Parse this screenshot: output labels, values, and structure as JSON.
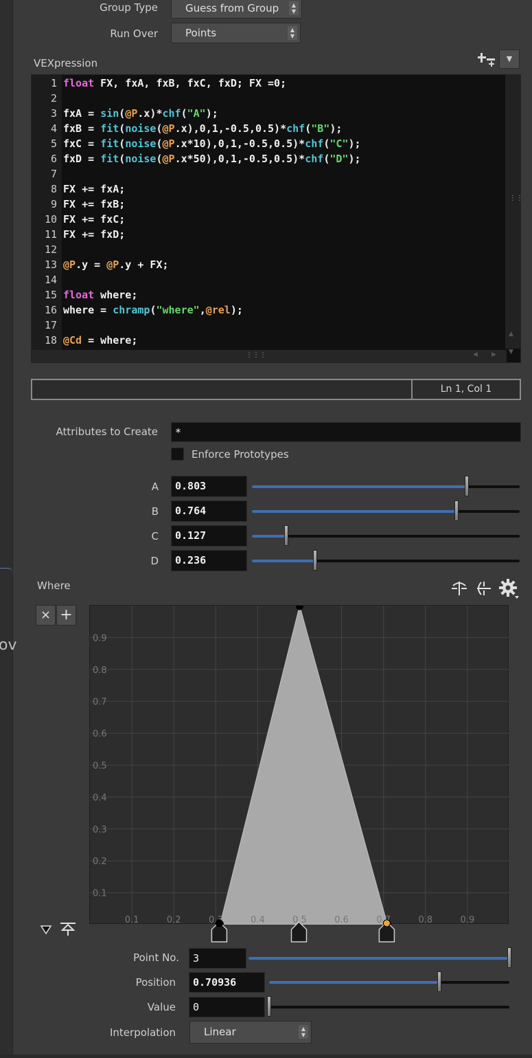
{
  "group_type": {
    "label": "Group Type",
    "value": "Guess from Group"
  },
  "run_over": {
    "label": "Run Over",
    "value": "Points"
  },
  "vexpression": {
    "label": "VEXpression",
    "lines": [
      {
        "n": "1",
        "html": "<span class=\"kw\">float</span> FX, fxA, fxB, fxC, fxD; FX =0;"
      },
      {
        "n": "2",
        "html": ""
      },
      {
        "n": "3",
        "html": "fxA = <span class=\"fn\">sin</span>(<span class=\"at\">@P</span>.x)*<span class=\"fn\">chf</span>(<span class=\"st\">\"A\"</span>);"
      },
      {
        "n": "4",
        "html": "fxB = <span class=\"fn\">fit</span>(<span class=\"fn\">noise</span>(<span class=\"at\">@P</span>.x),0,1,-0.5,0.5)*<span class=\"fn\">chf</span>(<span class=\"st\">\"B\"</span>);"
      },
      {
        "n": "5",
        "html": "fxC = <span class=\"fn\">fit</span>(<span class=\"fn\">noise</span>(<span class=\"at\">@P</span>.x*10),0,1,-0.5,0.5)*<span class=\"fn\">chf</span>(<span class=\"st\">\"C\"</span>);"
      },
      {
        "n": "6",
        "html": "fxD = <span class=\"fn\">fit</span>(<span class=\"fn\">noise</span>(<span class=\"at\">@P</span>.x*50),0,1,-0.5,0.5)*<span class=\"fn\">chf</span>(<span class=\"st\">\"D\"</span>);"
      },
      {
        "n": "7",
        "html": ""
      },
      {
        "n": "8",
        "html": "FX += fxA;"
      },
      {
        "n": "9",
        "html": "FX += fxB;"
      },
      {
        "n": "10",
        "html": "FX += fxC;"
      },
      {
        "n": "11",
        "html": "FX += fxD;"
      },
      {
        "n": "12",
        "html": ""
      },
      {
        "n": "13",
        "html": "<span class=\"at\">@P</span>.y = <span class=\"at\">@P</span>.y + FX;"
      },
      {
        "n": "14",
        "html": ""
      },
      {
        "n": "15",
        "html": "<span class=\"kw\">float</span> where;"
      },
      {
        "n": "16",
        "html": "where = <span class=\"fn\">chramp</span>(<span class=\"st\">\"where\"</span>,<span class=\"at\">@rel</span>);"
      },
      {
        "n": "17",
        "html": ""
      },
      {
        "n": "18",
        "html": "<span class=\"at\">@Cd</span> = where;"
      }
    ],
    "cursor_position": "Ln 1, Col 1"
  },
  "attributes_to_create": {
    "label": "Attributes to Create",
    "value": "*"
  },
  "enforce_prototypes": {
    "label": "Enforce Prototypes",
    "checked": false
  },
  "params": [
    {
      "label": "A",
      "value": "0.803",
      "fraction": 0.803
    },
    {
      "label": "B",
      "value": "0.764",
      "fraction": 0.764
    },
    {
      "label": "C",
      "value": "0.127",
      "fraction": 0.127
    },
    {
      "label": "D",
      "value": "0.236",
      "fraction": 0.236
    }
  ],
  "where_ramp": {
    "label": "Where",
    "x_ticks": [
      "0.1",
      "0.2",
      "0.3",
      "0.4",
      "0.5",
      "0.6",
      "0.7",
      "0.8",
      "0.9"
    ],
    "y_ticks": [
      "0.1",
      "0.2",
      "0.3",
      "0.4",
      "0.5",
      "0.6",
      "0.7",
      "0.8",
      "0.9"
    ],
    "points": [
      {
        "position": 0.31,
        "value": 0
      },
      {
        "position": 0.5,
        "value": 1
      },
      {
        "position": 0.70936,
        "value": 0
      }
    ],
    "selected_point": 3,
    "fill_color": "#a9a9a9",
    "selected_color": "#e8a640"
  },
  "point_no": {
    "label": "Point No.",
    "value": "3",
    "fraction": 1.0
  },
  "position": {
    "label": "Position",
    "value": "0.70936",
    "fraction": 0.70936
  },
  "value": {
    "label": "Value",
    "value": "0",
    "fraction": 0.0
  },
  "interpolation": {
    "label": "Interpolation",
    "value": "Linear"
  },
  "icons": {
    "add_remove": "add-remove-icon",
    "menu": "dropdown-arrow-icon",
    "gear": "gear-icon",
    "flip_h": "flip-horizontal-icon",
    "flip_v": "flip-vertical-icon",
    "close": "close-icon",
    "plus": "plus-icon",
    "collapse": "triangle-down-icon",
    "stack": "stack-icon"
  }
}
